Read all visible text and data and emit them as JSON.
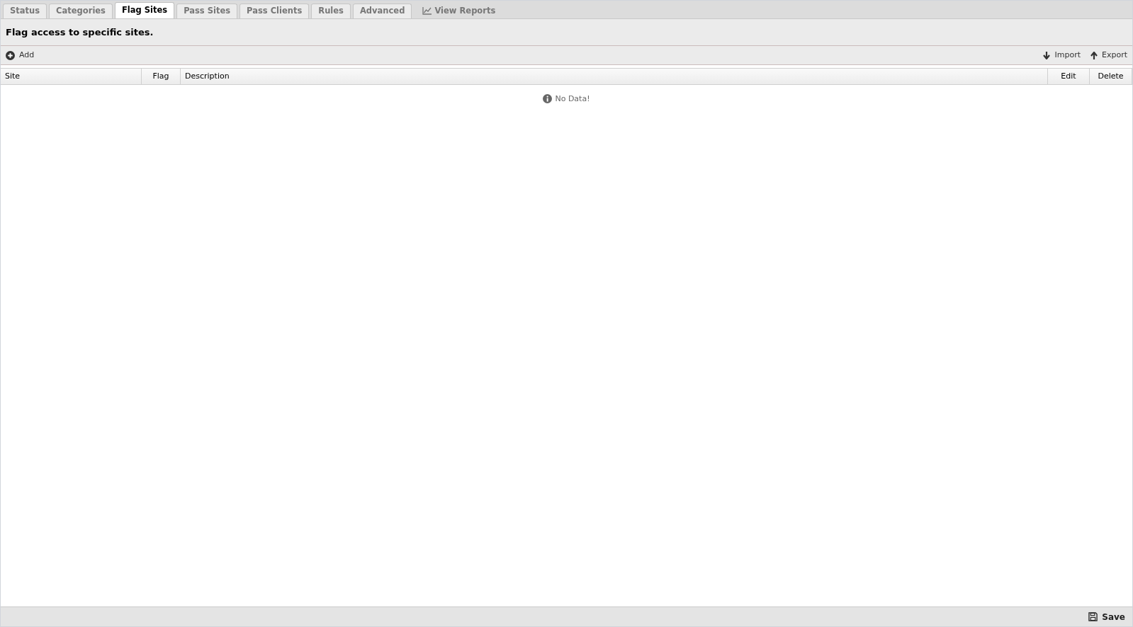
{
  "tabs": [
    {
      "label": "Status",
      "kind": "tab",
      "selected": false
    },
    {
      "label": "Categories",
      "kind": "tab",
      "selected": false
    },
    {
      "label": "Flag Sites",
      "kind": "tab",
      "selected": true
    },
    {
      "label": "Pass Sites",
      "kind": "tab",
      "selected": false
    },
    {
      "label": "Pass Clients",
      "kind": "tab",
      "selected": false
    },
    {
      "label": "Rules",
      "kind": "tab",
      "selected": false
    },
    {
      "label": "Advanced",
      "kind": "tab",
      "selected": false
    },
    {
      "label": "View Reports",
      "kind": "link",
      "selected": false
    }
  ],
  "panel": {
    "title": "Flag access to specific sites."
  },
  "toolbar": {
    "add": "Add",
    "import": "Import",
    "export": "Export"
  },
  "table": {
    "columns": [
      "Site",
      "Flag",
      "Description",
      "Edit",
      "Delete"
    ],
    "empty_message": "No Data!"
  },
  "footer": {
    "save": "Save"
  }
}
